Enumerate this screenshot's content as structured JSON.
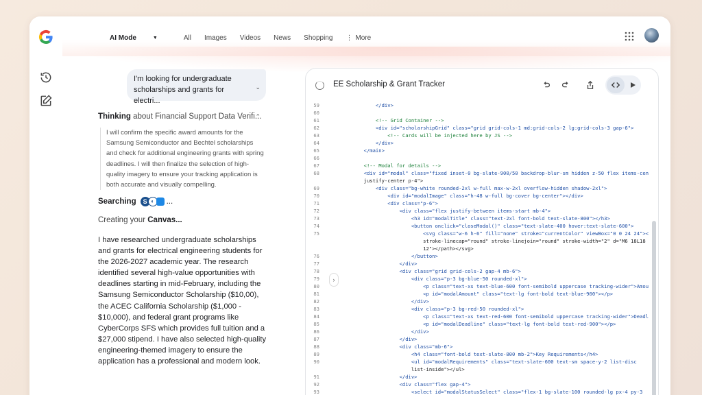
{
  "nav": {
    "ai_mode": "AI Mode",
    "tabs": [
      "All",
      "Images",
      "Videos",
      "News",
      "Shopping"
    ],
    "more": "More"
  },
  "chat": {
    "query": "I'm looking for undergraduate scholarships and grants for electri...",
    "thinking_label": "Thinking",
    "thinking_topic": "about Financial Support Data Verifi...",
    "thinking_body": "I will confirm the specific award amounts for the Samsung Semiconductor and Bechtel scholarships and check for additional engineering grants with spring deadlines. I will then finalize the selection of high-quality imagery to ensure your tracking application is both accurate and visually compelling.",
    "searching_label": "Searching",
    "searching_suffix": "...",
    "creating_prefix": "Creating your",
    "creating_target": "Canvas...",
    "answer": "I have researched undergraduate scholarships and grants for electrical engineering students for the 2026-2027 academic year. The research identified several high-value opportunities with deadlines starting in mid-February, including the Samsung Semiconductor Scholarship ($10,00), the ACEC California Scholarship ($1,000 - $10,000), and federal grant programs like CyberCorps SFS which provides full tuition and a $27,000 stipend. I have also selected high-quality engineering-themed imagery to ensure the application has a professional and modern look."
  },
  "canvas": {
    "title": "EE Scholarship & Grant Tracker",
    "lines": [
      {
        "n": "59",
        "t": "            </div>"
      },
      {
        "n": "60",
        "t": ""
      },
      {
        "n": "61",
        "t": "            <!-- Grid Container -->"
      },
      {
        "n": "62",
        "t": "            <div id=\"scholarshipGrid\" class=\"grid grid-cols-1 md:grid-cols-2 lg:grid-cols-3 gap-6\">"
      },
      {
        "n": "63",
        "t": "                <!-- Cards will be injected here by JS -->"
      },
      {
        "n": "64",
        "t": "            </div>"
      },
      {
        "n": "65",
        "t": "        </main>"
      },
      {
        "n": "66",
        "t": ""
      },
      {
        "n": "67",
        "t": "        <!-- Modal for details -->"
      },
      {
        "n": "68",
        "t": "        <div id=\"modal\" class=\"fixed inset-0 bg-slate-900/50 backdrop-blur-sm hidden z-50 flex items-center"
      },
      {
        "n": "",
        "t": "        justify-center p-4\">"
      },
      {
        "n": "69",
        "t": "            <div class=\"bg-white rounded-2xl w-full max-w-2xl overflow-hidden shadow-2xl\">"
      },
      {
        "n": "70",
        "t": "                <div id=\"modalImage\" class=\"h-48 w-full bg-cover bg-center\"></div>"
      },
      {
        "n": "71",
        "t": "                <div class=\"p-6\">"
      },
      {
        "n": "72",
        "t": "                    <div class=\"flex justify-between items-start mb-4\">"
      },
      {
        "n": "73",
        "t": "                        <h3 id=\"modalTitle\" class=\"text-2xl font-bold text-slate-800\"></h3>"
      },
      {
        "n": "74",
        "t": "                        <button onclick=\"closeModal()\" class=\"text-slate-400 hover:text-slate-600\">"
      },
      {
        "n": "75",
        "t": "                            <svg class=\"w-6 h-6\" fill=\"none\" stroke=\"currentColor\" viewBox=\"0 0 24 24\"><path"
      },
      {
        "n": "",
        "t": "                            stroke-linecap=\"round\" stroke-linejoin=\"round\" stroke-width=\"2\" d=\"M6 18L18 6M6 6l12"
      },
      {
        "n": "",
        "t": "                            12\"></path></svg>"
      },
      {
        "n": "76",
        "t": "                        </button>"
      },
      {
        "n": "77",
        "t": "                    </div>"
      },
      {
        "n": "78",
        "t": "                    <div class=\"grid grid-cols-2 gap-4 mb-6\">"
      },
      {
        "n": "79",
        "t": "                        <div class=\"p-3 bg-blue-50 rounded-xl\">"
      },
      {
        "n": "80",
        "t": "                            <p class=\"text-xs text-blue-600 font-semibold uppercase tracking-wider\">Amount</p>"
      },
      {
        "n": "81",
        "t": "                            <p id=\"modalAmount\" class=\"text-lg font-bold text-blue-900\"></p>"
      },
      {
        "n": "82",
        "t": "                        </div>"
      },
      {
        "n": "83",
        "t": "                        <div class=\"p-3 bg-red-50 rounded-xl\">"
      },
      {
        "n": "84",
        "t": "                            <p class=\"text-xs text-red-600 font-semibold uppercase tracking-wider\">Deadline</p>"
      },
      {
        "n": "85",
        "t": "                            <p id=\"modalDeadline\" class=\"text-lg font-bold text-red-900\"></p>"
      },
      {
        "n": "86",
        "t": "                        </div>"
      },
      {
        "n": "87",
        "t": "                    </div>"
      },
      {
        "n": "88",
        "t": "                    <div class=\"mb-6\">"
      },
      {
        "n": "89",
        "t": "                        <h4 class=\"font-bold text-slate-800 mb-2\">Key Requirements</h4>"
      },
      {
        "n": "90",
        "t": "                        <ul id=\"modalRequirements\" class=\"text-slate-600 text-sm space-y-2 list-disc"
      },
      {
        "n": "",
        "t": "                        list-inside\"></ul>"
      },
      {
        "n": "91",
        "t": "                    </div>"
      },
      {
        "n": "92",
        "t": "                    <div class=\"flex gap-4\">"
      },
      {
        "n": "93",
        "t": "                        <select id=\"modalStatusSelect\" class=\"flex-1 bg-slate-100 rounded-lg px-4 py-3"
      }
    ]
  }
}
